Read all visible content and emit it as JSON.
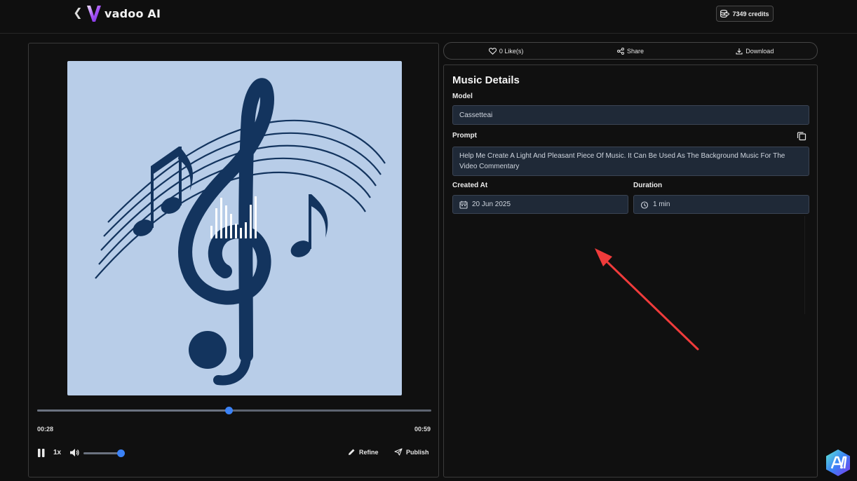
{
  "app": {
    "name": "vadoo AI",
    "back_icon": "chevron-left-icon",
    "credits_label": "7349 credits",
    "credits_icon": "coins-icon",
    "accent": "#3b82f6"
  },
  "player": {
    "current_time": "00:28",
    "total_time": "00:59",
    "progress_fraction": 0.485,
    "speed_label": "1x",
    "volume_fraction": 1.0,
    "refine_label": "Refine",
    "publish_label": "Publish"
  },
  "actions": {
    "likes_label": "0 Like(s)",
    "share_label": "Share",
    "download_label": "Download"
  },
  "details": {
    "title": "Music Details",
    "model_label": "Model",
    "model_value": "Cassetteai",
    "prompt_label": "Prompt",
    "prompt_value": "Help Me Create A Light And Pleasant Piece Of Music. It Can Be Used As The Background Music For The Video Commentary",
    "created_label": "Created At",
    "created_value": "20 Jun 2025",
    "duration_label": "Duration",
    "duration_value": "1 min"
  },
  "annotation": {
    "arrow_color": "#ef3b3b"
  }
}
